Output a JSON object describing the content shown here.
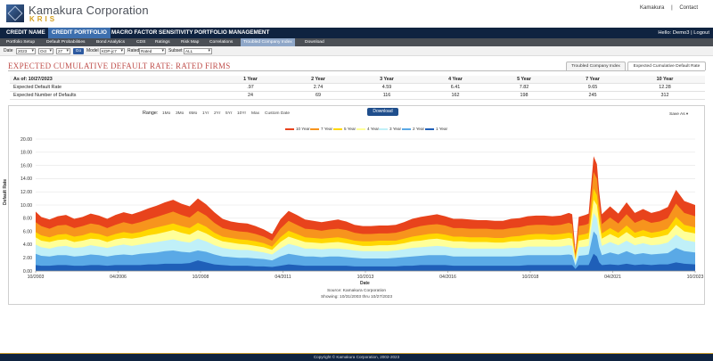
{
  "brand": {
    "name": "Kamakura Corporation",
    "sub": "KRIS"
  },
  "top_links": {
    "user": "Kamakura",
    "separator": "|",
    "contact": "Contact"
  },
  "main_nav": {
    "items": [
      "CREDIT NAME",
      "CREDIT PORTFOLIO",
      "MACRO FACTOR SENSITIVITY",
      "PORTFOLIO MANAGEMENT"
    ],
    "active_index": 1,
    "hello": "Hello: Demo3",
    "hello_separator": "|",
    "logout": "Logout"
  },
  "sub_nav": {
    "items": [
      "Portfolio Setup",
      "Default Probabilities",
      "Bond Analytics",
      "CDS",
      "Ratings",
      "Risk Map",
      "Correlations",
      "Troubled Company Index",
      "Download"
    ],
    "active_index": 7
  },
  "filters": {
    "date_label": "Date",
    "year": "2023",
    "month": "Oct",
    "day": "27",
    "go": "Go",
    "model_label": "Model",
    "model": "KDP-jc7",
    "rated_label": "Rated",
    "rated": "Rated",
    "subset_label": "Subset",
    "subset": "ALL"
  },
  "page": {
    "title": "EXPECTED CUMULATIVE DEFAULT RATE: RATED FIRMS",
    "tabs": [
      "Troubled Company Index",
      "Expected Cumulative Default Rate"
    ],
    "active_tab": 1
  },
  "summary": {
    "as_of": "As of: 10/27/2023",
    "columns": [
      "1 Year",
      "2 Year",
      "3 Year",
      "4 Year",
      "5 Year",
      "7 Year",
      "10 Year"
    ],
    "rows": [
      {
        "label": "Expected Default Rate",
        "values": [
          ".97",
          "2.74",
          "4.59",
          "6.41",
          "7.82",
          "9.65",
          "12.28"
        ]
      },
      {
        "label": "Expected Number of Defaults",
        "values": [
          "24",
          "69",
          "116",
          "162",
          "198",
          "245",
          "312"
        ]
      }
    ]
  },
  "chart_controls": {
    "range_label": "Range:",
    "ranges": [
      "1Mo",
      "3Mo",
      "6Mo",
      "1Yr",
      "2Yr",
      "5Yr",
      "10Yr",
      "Max",
      "Custom Date"
    ],
    "download": "Download",
    "save_as": "Save As"
  },
  "chart_data": {
    "type": "area",
    "xlabel": "Date",
    "ylabel": "Default Rate",
    "ylim": [
      0,
      20
    ],
    "yticks": [
      "0.00",
      "2.00",
      "4.00",
      "6.00",
      "8.00",
      "10.00",
      "12.00",
      "14.00",
      "16.00",
      "18.00",
      "20.00"
    ],
    "xticks": [
      "10/2003",
      "04/2006",
      "10/2008",
      "04/2011",
      "10/2013",
      "04/2016",
      "10/2018",
      "04/2021",
      "10/2023"
    ],
    "legend_position": "top-center",
    "grid": true,
    "x": [
      2003.83,
      2004.0,
      2004.25,
      2004.5,
      2004.75,
      2005.0,
      2005.25,
      2005.5,
      2005.75,
      2006.0,
      2006.25,
      2006.5,
      2006.75,
      2007.0,
      2007.25,
      2007.5,
      2007.75,
      2008.0,
      2008.25,
      2008.5,
      2008.75,
      2009.0,
      2009.25,
      2009.5,
      2009.75,
      2010.0,
      2010.25,
      2010.5,
      2010.75,
      2011.0,
      2011.25,
      2011.5,
      2011.75,
      2012.0,
      2012.25,
      2012.5,
      2012.75,
      2013.0,
      2013.25,
      2013.5,
      2013.75,
      2014.0,
      2014.25,
      2014.5,
      2014.75,
      2015.0,
      2015.25,
      2015.5,
      2015.75,
      2016.0,
      2016.25,
      2016.5,
      2016.75,
      2017.0,
      2017.25,
      2017.5,
      2017.75,
      2018.0,
      2018.25,
      2018.5,
      2018.75,
      2019.0,
      2019.25,
      2019.5,
      2019.75,
      2020.0,
      2020.1,
      2020.2,
      2020.3,
      2020.5,
      2020.6,
      2020.75,
      2020.85,
      2020.92,
      2021.0,
      2021.25,
      2021.5,
      2021.75,
      2022.0,
      2022.25,
      2022.5,
      2022.75,
      2023.0,
      2023.25,
      2023.5,
      2023.83
    ],
    "series": [
      {
        "name": "10 Year",
        "color": "#e8431c",
        "values": [
          9.0,
          8.2,
          7.8,
          8.3,
          8.5,
          7.9,
          8.2,
          8.7,
          8.4,
          7.9,
          8.5,
          8.9,
          8.6,
          9.0,
          9.5,
          9.9,
          10.4,
          10.8,
          10.2,
          9.8,
          11.0,
          10.1,
          8.9,
          7.9,
          7.5,
          7.3,
          7.2,
          6.8,
          6.3,
          5.6,
          7.8,
          9.1,
          8.5,
          7.8,
          7.6,
          7.4,
          7.6,
          7.8,
          7.5,
          7.0,
          6.8,
          6.8,
          6.9,
          6.9,
          7.0,
          7.4,
          7.9,
          8.2,
          8.4,
          8.6,
          8.3,
          7.9,
          7.9,
          7.8,
          7.7,
          7.7,
          7.6,
          7.6,
          7.9,
          8.0,
          8.3,
          8.4,
          8.4,
          8.3,
          8.4,
          8.8,
          8.6,
          3.0,
          8.2,
          8.5,
          8.7,
          17.4,
          16.2,
          12.0,
          8.6,
          9.8,
          8.7,
          10.4,
          8.8,
          9.4,
          8.8,
          9.1,
          9.7,
          12.3,
          10.6,
          10.0
        ]
      },
      {
        "name": "7 Year",
        "color": "#f7941d",
        "values": [
          7.4,
          6.8,
          6.4,
          6.9,
          7.0,
          6.5,
          6.8,
          7.2,
          7.0,
          6.5,
          7.0,
          7.4,
          7.1,
          7.4,
          7.8,
          8.2,
          8.6,
          9.0,
          8.5,
          8.1,
          9.1,
          8.4,
          7.3,
          6.5,
          6.2,
          6.0,
          5.9,
          5.6,
          5.2,
          4.6,
          6.4,
          7.6,
          7.0,
          6.4,
          6.3,
          6.1,
          6.3,
          6.4,
          6.2,
          5.8,
          5.6,
          5.6,
          5.7,
          5.7,
          5.8,
          6.1,
          6.5,
          6.8,
          7.0,
          7.1,
          6.9,
          6.5,
          6.5,
          6.4,
          6.4,
          6.4,
          6.3,
          6.3,
          6.5,
          6.6,
          6.9,
          7.0,
          7.0,
          6.9,
          7.0,
          7.3,
          7.1,
          2.5,
          6.8,
          7.0,
          7.2,
          15.0,
          14.0,
          10.2,
          7.1,
          8.1,
          7.2,
          8.6,
          7.3,
          7.8,
          7.3,
          7.5,
          8.0,
          10.2,
          8.8,
          8.3
        ]
      },
      {
        "name": "5 Year",
        "color": "#ffd700",
        "values": [
          5.9,
          5.4,
          5.1,
          5.5,
          5.6,
          5.2,
          5.4,
          5.8,
          5.6,
          5.2,
          5.6,
          5.9,
          5.7,
          5.9,
          6.3,
          6.6,
          6.9,
          7.2,
          6.8,
          6.5,
          7.3,
          6.7,
          5.8,
          5.2,
          5.0,
          4.8,
          4.7,
          4.5,
          4.2,
          3.7,
          5.1,
          6.1,
          5.6,
          5.1,
          5.0,
          4.9,
          5.0,
          5.1,
          4.9,
          4.6,
          4.5,
          4.5,
          4.6,
          4.6,
          4.6,
          4.9,
          5.2,
          5.4,
          5.6,
          5.7,
          5.5,
          5.2,
          5.2,
          5.1,
          5.1,
          5.1,
          5.0,
          5.0,
          5.2,
          5.3,
          5.5,
          5.6,
          5.6,
          5.5,
          5.6,
          5.8,
          5.7,
          2.0,
          5.4,
          5.6,
          5.8,
          12.5,
          11.5,
          8.4,
          5.7,
          6.5,
          5.8,
          6.9,
          5.8,
          6.2,
          5.8,
          6.0,
          6.4,
          8.2,
          7.0,
          6.6
        ]
      },
      {
        "name": "4 Year",
        "color": "#ffff99",
        "values": [
          5.1,
          4.6,
          4.4,
          4.7,
          4.8,
          4.4,
          4.6,
          4.9,
          4.8,
          4.4,
          4.8,
          5.0,
          4.9,
          5.1,
          5.4,
          5.6,
          5.9,
          6.2,
          5.8,
          5.5,
          6.2,
          5.7,
          5.0,
          4.5,
          4.3,
          4.1,
          4.0,
          3.8,
          3.6,
          3.2,
          4.4,
          5.2,
          4.8,
          4.4,
          4.3,
          4.2,
          4.3,
          4.4,
          4.2,
          4.0,
          3.8,
          3.8,
          3.9,
          3.9,
          4.0,
          4.2,
          4.5,
          4.6,
          4.8,
          4.9,
          4.7,
          4.5,
          4.5,
          4.4,
          4.4,
          4.4,
          4.3,
          4.3,
          4.5,
          4.5,
          4.7,
          4.8,
          4.8,
          4.7,
          4.8,
          5.0,
          4.9,
          1.7,
          4.6,
          4.8,
          4.9,
          10.8,
          10.0,
          7.2,
          4.9,
          5.6,
          5.0,
          5.9,
          5.0,
          5.3,
          5.0,
          5.2,
          5.5,
          7.0,
          6.0,
          5.7
        ]
      },
      {
        "name": "3 Year",
        "color": "#c0f0f8",
        "values": [
          4.0,
          3.6,
          3.4,
          3.7,
          3.8,
          3.5,
          3.6,
          3.9,
          3.7,
          3.5,
          3.8,
          4.0,
          3.8,
          4.0,
          4.2,
          4.4,
          4.6,
          4.8,
          4.5,
          4.3,
          4.9,
          4.5,
          3.9,
          3.5,
          3.3,
          3.2,
          3.2,
          3.0,
          2.8,
          2.5,
          3.4,
          4.1,
          3.8,
          3.4,
          3.4,
          3.3,
          3.4,
          3.4,
          3.3,
          3.1,
          3.0,
          3.0,
          3.0,
          3.0,
          3.1,
          3.3,
          3.5,
          3.6,
          3.7,
          3.8,
          3.7,
          3.5,
          3.5,
          3.4,
          3.4,
          3.4,
          3.4,
          3.4,
          3.5,
          3.5,
          3.7,
          3.7,
          3.7,
          3.7,
          3.7,
          3.9,
          3.8,
          1.3,
          3.6,
          3.7,
          3.8,
          8.8,
          8.0,
          5.6,
          3.8,
          4.4,
          3.9,
          4.6,
          3.9,
          4.2,
          3.9,
          4.0,
          4.3,
          5.5,
          4.7,
          4.4
        ]
      },
      {
        "name": "2 Year",
        "color": "#5aa9e6",
        "values": [
          2.6,
          2.3,
          2.2,
          2.4,
          2.4,
          2.2,
          2.3,
          2.5,
          2.4,
          2.2,
          2.4,
          2.5,
          2.4,
          2.6,
          2.7,
          2.8,
          3.0,
          3.1,
          2.9,
          2.8,
          3.1,
          2.9,
          2.5,
          2.2,
          2.1,
          2.0,
          2.0,
          1.9,
          1.8,
          1.6,
          2.2,
          2.6,
          2.4,
          2.2,
          2.2,
          2.1,
          2.2,
          2.2,
          2.1,
          2.0,
          1.9,
          1.9,
          1.9,
          1.9,
          2.0,
          2.1,
          2.2,
          2.3,
          2.4,
          2.4,
          2.4,
          2.2,
          2.2,
          2.2,
          2.2,
          2.2,
          2.2,
          2.2,
          2.2,
          2.3,
          2.4,
          2.4,
          2.4,
          2.4,
          2.4,
          2.5,
          2.4,
          0.8,
          2.3,
          2.4,
          2.5,
          6.0,
          5.4,
          3.6,
          2.4,
          2.8,
          2.5,
          3.0,
          2.5,
          2.7,
          2.5,
          2.6,
          2.7,
          3.5,
          3.0,
          2.8
        ]
      },
      {
        "name": "1 Year",
        "color": "#1f5fb8",
        "values": [
          0.9,
          0.8,
          0.8,
          0.9,
          0.9,
          0.8,
          0.8,
          0.9,
          0.9,
          0.8,
          0.9,
          0.9,
          0.9,
          0.9,
          1.0,
          1.0,
          1.1,
          1.1,
          1.1,
          1.2,
          1.6,
          1.3,
          1.0,
          0.9,
          0.8,
          0.8,
          0.8,
          0.7,
          0.7,
          0.6,
          0.8,
          1.0,
          0.9,
          0.8,
          0.8,
          0.8,
          0.8,
          0.8,
          0.8,
          0.7,
          0.7,
          0.7,
          0.7,
          0.7,
          0.7,
          0.8,
          0.8,
          0.9,
          0.9,
          0.9,
          0.9,
          0.8,
          0.8,
          0.8,
          0.8,
          0.8,
          0.8,
          0.8,
          0.8,
          0.8,
          0.9,
          0.9,
          0.9,
          0.9,
          0.9,
          0.9,
          0.9,
          0.3,
          0.9,
          0.9,
          0.9,
          2.6,
          2.2,
          1.3,
          0.9,
          1.0,
          0.9,
          1.1,
          0.9,
          1.0,
          0.9,
          1.0,
          1.0,
          1.3,
          1.1,
          1.0
        ]
      }
    ]
  },
  "chart_footer": {
    "source": "Source: Kamakura Corporation",
    "showing": "Showing: 10/31/2003 thru 10/27/2023"
  },
  "footer": {
    "copyright": "Copyright © Kamakura Corporation, 2002-2023"
  }
}
